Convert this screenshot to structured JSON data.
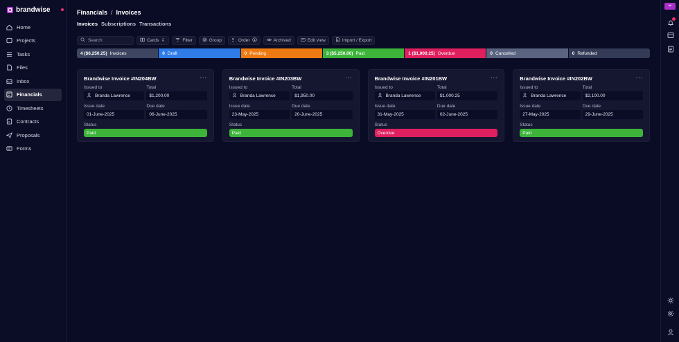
{
  "brand": {
    "name": "brandwise",
    "accent": "#c03fdc",
    "dot_color": "#e8336b"
  },
  "sidebar": {
    "items": [
      {
        "label": "Home",
        "icon": "home-icon"
      },
      {
        "label": "Projects",
        "icon": "folder-icon"
      },
      {
        "label": "Tasks",
        "icon": "checklist-icon"
      },
      {
        "label": "Files",
        "icon": "file-icon"
      },
      {
        "label": "Inbox",
        "icon": "inbox-icon"
      },
      {
        "label": "Financials",
        "icon": "receipt-icon",
        "active": true
      },
      {
        "label": "Timesheets",
        "icon": "clock-icon"
      },
      {
        "label": "Contracts",
        "icon": "contract-icon"
      },
      {
        "label": "Proposals",
        "icon": "send-icon"
      },
      {
        "label": "Forms",
        "icon": "form-icon"
      }
    ]
  },
  "header": {
    "breadcrumb": {
      "parent": "Financials",
      "separator": "/",
      "current": "Invoices"
    },
    "tabs": [
      {
        "label": "Invoices",
        "active": true
      },
      {
        "label": "Subscriptions"
      },
      {
        "label": "Transactions"
      }
    ]
  },
  "toolbar": {
    "search_placeholder": "Search",
    "cards_label": "Cards",
    "filter_label": "Filter",
    "group_label": "Group",
    "order_label": "Order",
    "archived_label": "Archived",
    "edit_view_label": "Edit view",
    "import_export_label": "Import / Export"
  },
  "status_summary": [
    {
      "count": "4 ($6,250.25)",
      "label": "Invoices",
      "color": "#3d4560"
    },
    {
      "count": "0",
      "label": "Draft",
      "color": "#2f7be8"
    },
    {
      "count": "0",
      "label": "Pending",
      "color": "#ee7a12"
    },
    {
      "count": "3 ($5,250.00)",
      "label": "Paid",
      "color": "#3db33a"
    },
    {
      "count": "1 ($1,000.25)",
      "label": "Overdue",
      "color": "#e01f5e"
    },
    {
      "count": "0",
      "label": "Cancelled",
      "color": "#5a6380"
    },
    {
      "count": "0",
      "label": "Refunded",
      "color": "#343b57"
    }
  ],
  "labels": {
    "issued_to": "Issued to",
    "total": "Total",
    "issue_date": "Issue date",
    "due_date": "Due date",
    "status": "Status",
    "menu": "···"
  },
  "invoices": [
    {
      "title": "Brandwise Invoice #IN204BW",
      "issued_to": "Branda Lawrence",
      "total": "$1,200.00",
      "issue_date": "01-June-2025",
      "due_date": "06-June-2025",
      "status": "Paid",
      "status_color": "#3db33a"
    },
    {
      "title": "Brandwise Invoice #IN203BW",
      "issued_to": "Branda Lawrence",
      "total": "$1,950.00",
      "issue_date": "23-May-2025",
      "due_date": "20-June-2025",
      "status": "Paid",
      "status_color": "#3db33a"
    },
    {
      "title": "Brandwise Invoice #IN201BW",
      "issued_to": "Branda Lawrence",
      "total": "$1,000.25",
      "issue_date": "31-May-2025",
      "due_date": "02-June-2025",
      "status": "Overdue",
      "status_color": "#e01f5e"
    },
    {
      "title": "Brandwise Invoice #IN202BW",
      "issued_to": "Branda Lawrence",
      "total": "$2,100.00",
      "issue_date": "27-May-2025",
      "due_date": "29-June-2025",
      "status": "Paid",
      "status_color": "#3db33a"
    }
  ],
  "rail": {
    "notification_badge": "1",
    "icons": [
      "chevron-down-icon",
      "bell-icon",
      "inbox-tray-icon",
      "document-icon",
      "sun-icon",
      "gear-icon",
      "user-icon"
    ]
  }
}
